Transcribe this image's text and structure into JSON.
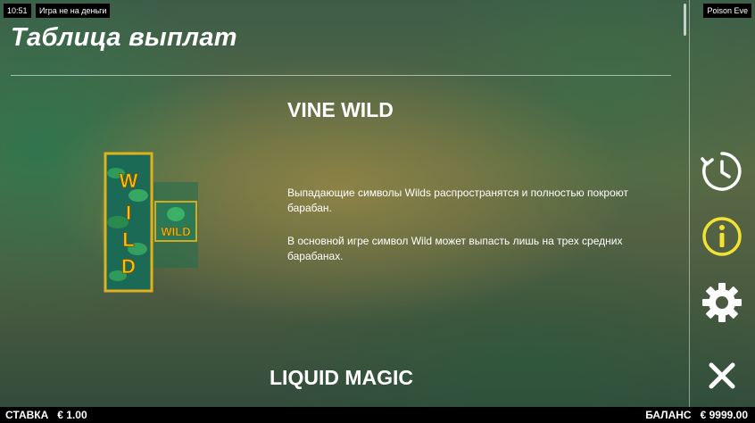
{
  "status_bar": {
    "time": "10:51",
    "mode": "Игра не на деньги",
    "game_name": "Poison Eve"
  },
  "page": {
    "title": "Таблица выплат"
  },
  "section": {
    "heading": "VINE WILD",
    "paragraph_1": "Выпадающие символы Wilds распространятся и полностью покроют барабан.",
    "paragraph_2": "В основной игре символ Wild может выпасть лишь на трех средних барабанах.",
    "symbol_text_large": "WILD",
    "symbol_text_small": "WILD",
    "next_heading": "LIQUID MAGIC"
  },
  "sidebar": {
    "icons": [
      "history-icon",
      "info-icon",
      "gear-icon",
      "close-icon"
    ],
    "accent_color": "#f2e233"
  },
  "footer": {
    "bet_label": "СТАВКА",
    "bet_value": "€ 1.00",
    "balance_label": "БАЛАНС",
    "balance_value": "€ 9999.00"
  }
}
